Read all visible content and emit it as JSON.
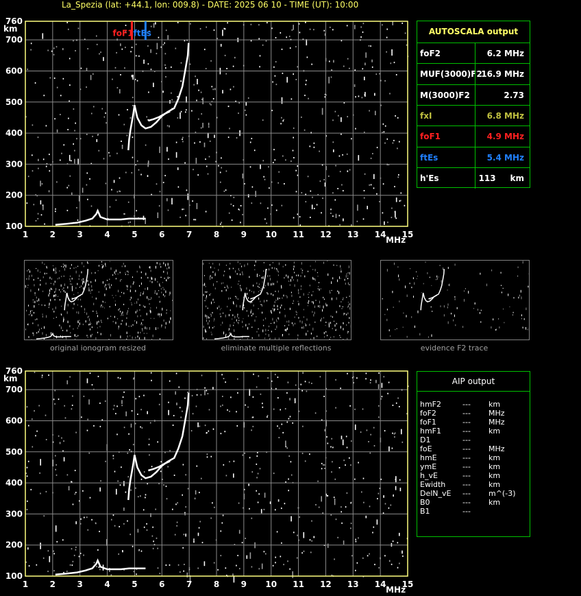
{
  "header": {
    "title": "La_Spezia (lat: +44.1, lon: 009.8) - DATE: 2025 06 10 - TIME (UT): 10:00"
  },
  "colors": {
    "axis": "#ffff80",
    "grid": "#8a8a8a",
    "trace": "#ffffff",
    "foF1": "#ff2020",
    "ftEs": "#2080ff",
    "fxI": "#c0c040",
    "border": "#00c000"
  },
  "chart_data": [
    {
      "type": "scatter",
      "name_hint": "main-ionogram",
      "xlabel": "MHz",
      "ylabel": "km",
      "xlim": [
        1,
        15
      ],
      "ylim": [
        100,
        760
      ],
      "x_ticks": [
        "1",
        "2",
        "3",
        "4",
        "5",
        "6",
        "7",
        "8",
        "9",
        "10",
        "11",
        "12",
        "13",
        "14",
        "15"
      ],
      "y_ticks": [
        "100",
        "200",
        "300",
        "400",
        "500",
        "600",
        "700",
        "760"
      ],
      "markers": [
        {
          "label": "foF1",
          "freq": 4.9,
          "color": "#ff2020"
        },
        {
          "label": "ftEs",
          "freq": 5.4,
          "color": "#2080ff"
        }
      ],
      "traces": [
        {
          "points": [
            [
              2.1,
              105
            ],
            [
              2.5,
              108
            ],
            [
              2.9,
              112
            ],
            [
              3.2,
              118
            ],
            [
              3.45,
              125
            ],
            [
              3.6,
              140
            ],
            [
              3.65,
              150
            ],
            [
              3.75,
              130
            ],
            [
              4.0,
              122
            ],
            [
              4.5,
              122
            ],
            [
              4.8,
              125
            ],
            [
              5.4,
              125
            ]
          ]
        },
        {
          "points": [
            [
              4.77,
              345
            ],
            [
              4.8,
              380
            ],
            [
              4.85,
              410
            ],
            [
              4.95,
              460
            ],
            [
              5.0,
              490
            ],
            [
              5.1,
              450
            ],
            [
              5.25,
              425
            ],
            [
              5.4,
              415
            ],
            [
              5.6,
              420
            ],
            [
              5.8,
              435
            ],
            [
              6.0,
              455
            ],
            [
              6.2,
              468
            ],
            [
              6.45,
              480
            ],
            [
              6.6,
              510
            ],
            [
              6.75,
              550
            ],
            [
              6.85,
              600
            ],
            [
              6.95,
              650
            ],
            [
              6.98,
              690
            ]
          ]
        },
        {
          "points": [
            [
              5.5,
              440
            ],
            [
              5.7,
              445
            ],
            [
              5.9,
              452
            ],
            [
              6.1,
              462
            ],
            [
              6.3,
              470
            ]
          ]
        }
      ]
    },
    {
      "type": "scatter",
      "name_hint": "aip-ionogram",
      "xlabel": "MHz",
      "ylabel": "km",
      "xlim": [
        1,
        15
      ],
      "ylim": [
        100,
        760
      ],
      "x_ticks": [
        "1",
        "2",
        "3",
        "4",
        "5",
        "6",
        "7",
        "8",
        "9",
        "10",
        "11",
        "12",
        "13",
        "14",
        "15"
      ],
      "y_ticks": [
        "100",
        "200",
        "300",
        "400",
        "500",
        "600",
        "700",
        "760"
      ]
    }
  ],
  "autoscala": {
    "title": "AUTOSCALA output",
    "rows": [
      {
        "key": "foF2",
        "value": "6.2 MHz",
        "kcolor": "#ffffff",
        "vcolor": "#ffffff"
      },
      {
        "key": "MUF(3000)F2",
        "value": "16.9 MHz",
        "kcolor": "#ffffff",
        "vcolor": "#ffffff"
      },
      {
        "key": "M(3000)F2",
        "value": "2.73",
        "kcolor": "#ffffff",
        "vcolor": "#ffffff"
      },
      {
        "key": "fxI",
        "value": "6.8 MHz",
        "kcolor": "#c0c040",
        "vcolor": "#c0c040"
      },
      {
        "key": "foF1",
        "value": "4.9 MHz",
        "kcolor": "#ff2020",
        "vcolor": "#ff2020"
      },
      {
        "key": "ftEs",
        "value": "5.4 MHz",
        "kcolor": "#2080ff",
        "vcolor": "#2080ff"
      },
      {
        "key": "h'Es",
        "value": "113     km",
        "kcolor": "#ffffff",
        "vcolor": "#ffffff"
      }
    ]
  },
  "aip": {
    "title": "AIP output",
    "rows": [
      {
        "k": "hmF2",
        "d": "---",
        "u": "km"
      },
      {
        "k": "foF2",
        "d": "---",
        "u": "MHz"
      },
      {
        "k": "foF1",
        "d": "---",
        "u": "MHz"
      },
      {
        "k": "hmF1",
        "d": "---",
        "u": "km"
      },
      {
        "k": "D1",
        "d": "---",
        "u": ""
      },
      {
        "k": "foE",
        "d": "---",
        "u": "MHz"
      },
      {
        "k": "hmE",
        "d": "---",
        "u": "km"
      },
      {
        "k": "ymE",
        "d": "---",
        "u": "km"
      },
      {
        "k": "h_vE",
        "d": "---",
        "u": "km"
      },
      {
        "k": "Ewidth",
        "d": "---",
        "u": "km"
      },
      {
        "k": "DelN_vE",
        "d": "---",
        "u": "m^(-3)"
      },
      {
        "k": "B0",
        "d": "---",
        "u": "km"
      },
      {
        "k": "B1",
        "d": "---",
        "u": ""
      }
    ]
  },
  "thumbs": [
    {
      "caption": "original ionogram resized"
    },
    {
      "caption": "eliminate multiple reflections"
    },
    {
      "caption": "evidence F2 trace"
    }
  ]
}
